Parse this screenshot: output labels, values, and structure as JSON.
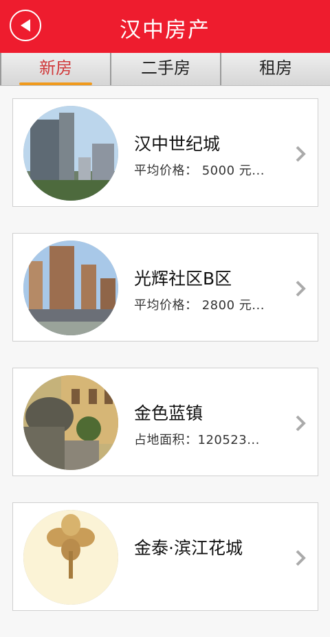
{
  "header": {
    "title": "汉中房产",
    "back_icon": "back-arrow-icon"
  },
  "tabs": [
    {
      "label": "新房",
      "active": true
    },
    {
      "label": "二手房",
      "active": false
    },
    {
      "label": "租房",
      "active": false
    }
  ],
  "listings": [
    {
      "name": "汉中世纪城",
      "detail": "平均价格： 5000 元...",
      "image": "residential-tower-photo"
    },
    {
      "name": "光辉社区B区",
      "detail": "平均价格： 2800 元...",
      "image": "apartment-complex-photo"
    },
    {
      "name": "金色蓝镇",
      "detail": "占地面积：120523...",
      "image": "sculpture-plaza-photo"
    },
    {
      "name": "金泰·滨江花城",
      "detail": "",
      "image": "flower-logo-photo"
    }
  ],
  "colors": {
    "header_bg": "#ee1c2e",
    "active_tab": "#d0393a",
    "tab_underline": "#f09a1d"
  }
}
